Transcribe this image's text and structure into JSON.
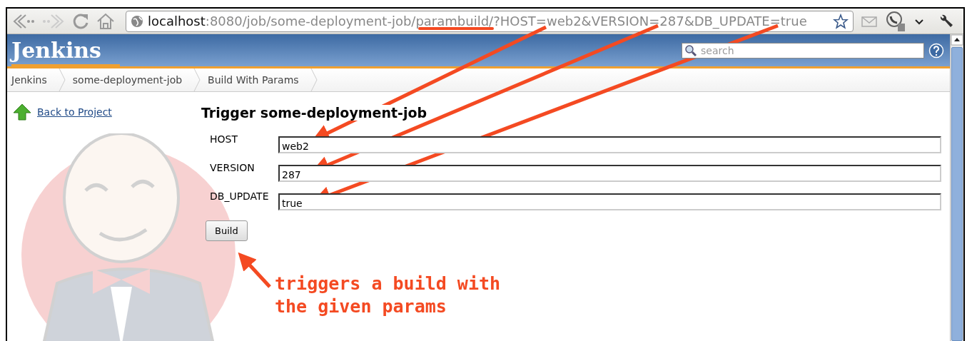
{
  "browser": {
    "url_host": "localhost",
    "url_rest": ":8080/job/some-deployment-job/parambuild/?HOST=web2&VERSION=287&DB_UPDATE=true"
  },
  "header": {
    "logo": "Jenkins",
    "search": {
      "placeholder": "search"
    }
  },
  "breadcrumbs": [
    {
      "label": "Jenkins"
    },
    {
      "label": "some-deployment-job"
    },
    {
      "label": "Build With Params"
    }
  ],
  "sidebar": {
    "items": [
      {
        "label": "Back to Project"
      }
    ]
  },
  "form": {
    "title": "Trigger some-deployment-job",
    "params": [
      {
        "name": "HOST",
        "value": "web2"
      },
      {
        "name": "VERSION",
        "value": "287"
      },
      {
        "name": "DB_UPDATE",
        "value": "true"
      }
    ],
    "submit": "Build"
  },
  "annotation": {
    "lines": [
      "triggers a build with",
      "the given params"
    ]
  }
}
